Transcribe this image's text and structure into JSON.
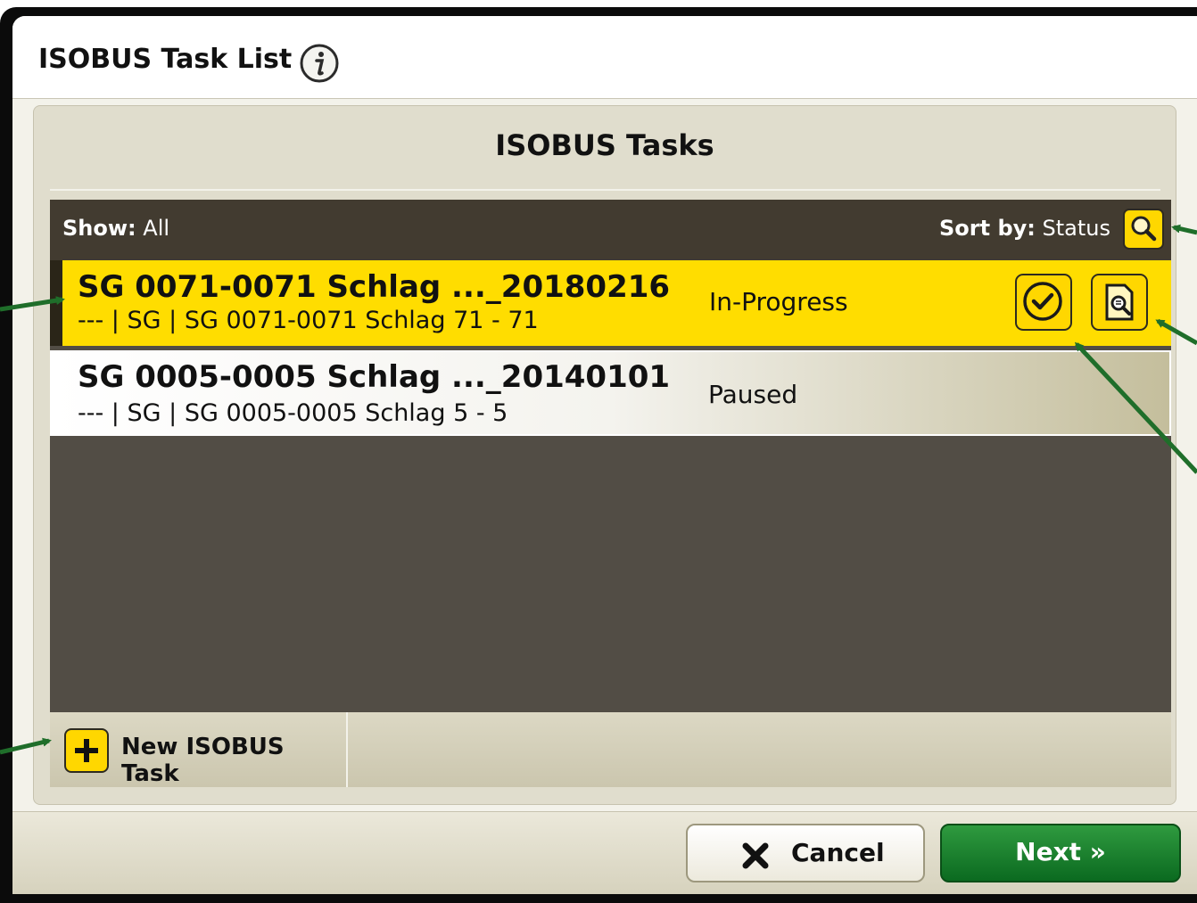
{
  "window": {
    "title": "ISOBUS Task List"
  },
  "panel": {
    "heading": "ISOBUS Tasks"
  },
  "toolbar": {
    "show_label": "Show:",
    "show_value": "All",
    "sort_label": "Sort by:",
    "sort_value": "Status"
  },
  "tasks": [
    {
      "name": "SG 0071-0071 Schlag ..._20180216",
      "details": "--- | SG | SG 0071-0071 Schlag 71 - 71",
      "status": "In-Progress",
      "selected": true
    },
    {
      "name": "SG 0005-0005 Schlag ..._20140101",
      "details": "--- | SG | SG 0005-0005 Schlag 5 - 5",
      "status": "Paused",
      "selected": false
    }
  ],
  "actions": {
    "new_task_label": "New ISOBUS Task",
    "cancel_label": "Cancel",
    "next_label": "Next »"
  },
  "colors": {
    "accent_yellow": "#ffdd00",
    "toolbar_brown": "#423b30",
    "list_background": "#524d45",
    "next_green": "#1c7f2f",
    "annotation_arrow": "#1f6e2a"
  },
  "icons": {
    "info": "info-icon",
    "sort": "search-icon",
    "complete": "checkmark-icon",
    "view": "document-search-icon",
    "add": "plus-icon",
    "cancel": "close-icon"
  }
}
